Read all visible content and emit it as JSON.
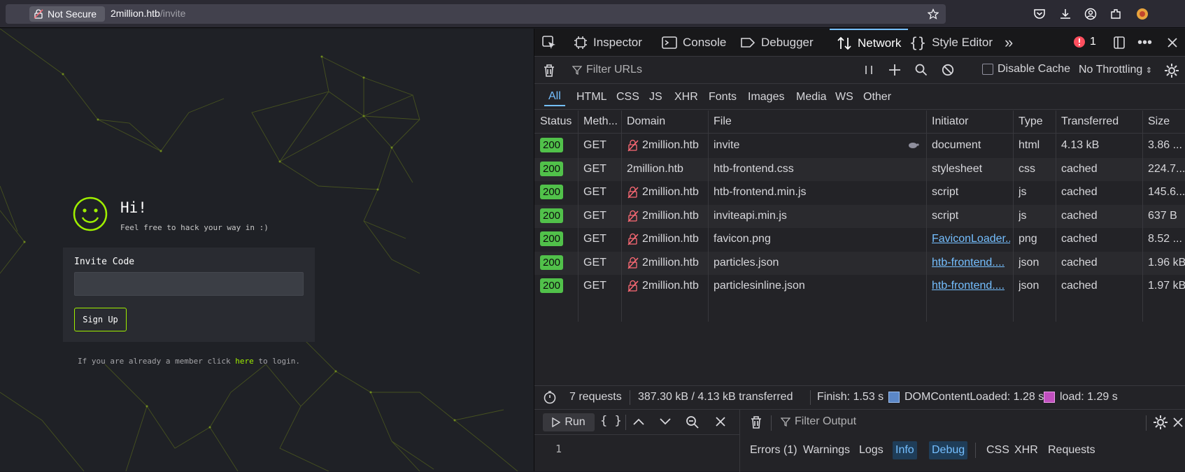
{
  "browser": {
    "security_label": "Not Secure",
    "url_host": "2million.htb",
    "url_path": "/invite",
    "toolbar_icons": [
      "pocket-icon",
      "downloads-icon",
      "account-icon",
      "extensions-icon",
      "addon-icon"
    ]
  },
  "page": {
    "greeting": "Hi!",
    "subtitle": "Feel free to hack your way in :)",
    "invite_label": "Invite Code",
    "invite_value": "",
    "signup_label": "Sign Up",
    "login_prefix": "If you are already a member click ",
    "login_link": "here",
    "login_suffix": " to login.",
    "accent": "#9fef00"
  },
  "devtools": {
    "tabs": [
      "Inspector",
      "Console",
      "Debugger",
      "Network",
      "Style Editor"
    ],
    "selected_tab": "Network",
    "error_count": "1",
    "filter_placeholder": "Filter URLs",
    "disable_cache_label": "Disable Cache",
    "throttling": "No Throttling",
    "type_filters": [
      "All",
      "HTML",
      "CSS",
      "JS",
      "XHR",
      "Fonts",
      "Images",
      "Media",
      "WS",
      "Other"
    ],
    "columns": [
      "Status",
      "Meth...",
      "Domain",
      "File",
      "Initiator",
      "Type",
      "Transferred",
      "Size"
    ],
    "requests": [
      {
        "status": "200",
        "method": "GET",
        "domain": "2million.htb",
        "file": "invite",
        "initiator": "document",
        "type": "html",
        "transferred": "4.13 kB",
        "size": "3.86 ..."
      },
      {
        "status": "200",
        "method": "GET",
        "domain": "2million.htb",
        "file": "htb-frontend.css",
        "initiator": "stylesheet",
        "type": "css",
        "transferred": "cached",
        "size": "224.7..."
      },
      {
        "status": "200",
        "method": "GET",
        "domain": "2million.htb",
        "file": "htb-frontend.min.js",
        "initiator": "script",
        "type": "js",
        "transferred": "cached",
        "size": "145.6..."
      },
      {
        "status": "200",
        "method": "GET",
        "domain": "2million.htb",
        "file": "inviteapi.min.js",
        "initiator": "script",
        "type": "js",
        "transferred": "cached",
        "size": "637 B"
      },
      {
        "status": "200",
        "method": "GET",
        "domain": "2million.htb",
        "file": "favicon.png",
        "initiator": "FaviconLoader...",
        "type": "png",
        "transferred": "cached",
        "size": "8.52 ..."
      },
      {
        "status": "200",
        "method": "GET",
        "domain": "2million.htb",
        "file": "particles.json",
        "initiator": "htb-frontend....",
        "type": "json",
        "transferred": "cached",
        "size": "1.96 kB"
      },
      {
        "status": "200",
        "method": "GET",
        "domain": "2million.htb",
        "file": "particlesinline.json",
        "initiator": "htb-frontend....",
        "type": "json",
        "transferred": "cached",
        "size": "1.97 kB"
      }
    ],
    "summary": {
      "requests": "7 requests",
      "transferred": "387.30 kB / 4.13 kB transferred",
      "finish": "Finish: 1.53 s",
      "dom_loaded": "DOMContentLoaded: 1.28 s",
      "load": "load: 1.29 s"
    },
    "console": {
      "run_label": "Run",
      "line_number": "1",
      "filter_placeholder": "Filter Output",
      "filters": [
        "Errors (1)",
        "Warnings",
        "Logs",
        "Info",
        "Debug",
        "CSS",
        "XHR",
        "Requests"
      ]
    }
  }
}
